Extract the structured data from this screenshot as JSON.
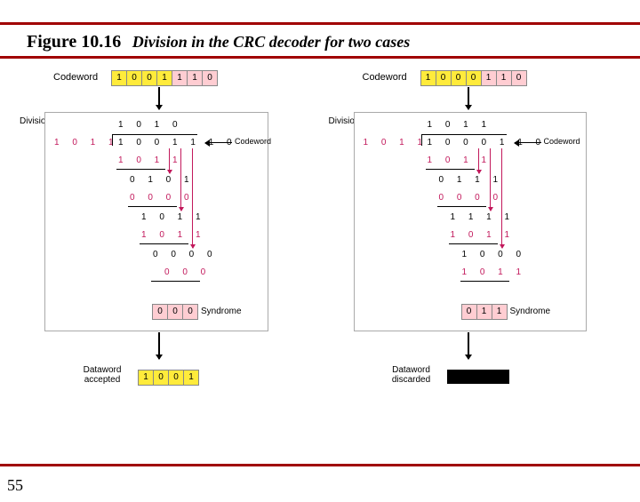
{
  "header": {
    "figure": "Figure 10.16",
    "title": "Division in the CRC decoder for two cases"
  },
  "left": {
    "codeword_label": "Codeword",
    "codeword": [
      "1",
      "0",
      "0",
      "1",
      "1",
      "1",
      "0"
    ],
    "division_label": "Division",
    "quotient": "1 0 1 0",
    "divisor": "1 0 1 1",
    "dividend": "1 0 0 1 1 1 0",
    "cw_label": "Codeword",
    "step1": "1 0 1 1",
    "step2": "0 1 0 1",
    "step3": "0 0 0 0",
    "step4": "1 0 1 1",
    "step5": "1 0 1 1",
    "step6": "0 0 0 0",
    "step7": "0 0 0",
    "syndrome": [
      "0",
      "0",
      "0"
    ],
    "syndrome_label": "Syndrome",
    "result_l1": "Dataword",
    "result_l2": "accepted",
    "dataword": [
      "1",
      "0",
      "0",
      "1"
    ]
  },
  "right": {
    "codeword_label": "Codeword",
    "codeword": [
      "1",
      "0",
      "0",
      "0",
      "1",
      "1",
      "0"
    ],
    "division_label": "Division",
    "quotient": "1 0 1 1",
    "divisor": "1 0 1 1",
    "dividend": "1 0 0 0 1 1 0",
    "cw_label": "Codeword",
    "step1": "1 0 1 1",
    "step2": "0 1 1 1",
    "step3": "0 0 0 0",
    "step4": "1 1 1 1",
    "step5": "1 0 1 1",
    "step6": "1 0 0 0",
    "step7": "1 0 1 1",
    "syndrome": [
      "0",
      "1",
      "1"
    ],
    "syndrome_label": "Syndrome",
    "result_l1": "Dataword",
    "result_l2": "discarded"
  },
  "page": "55"
}
